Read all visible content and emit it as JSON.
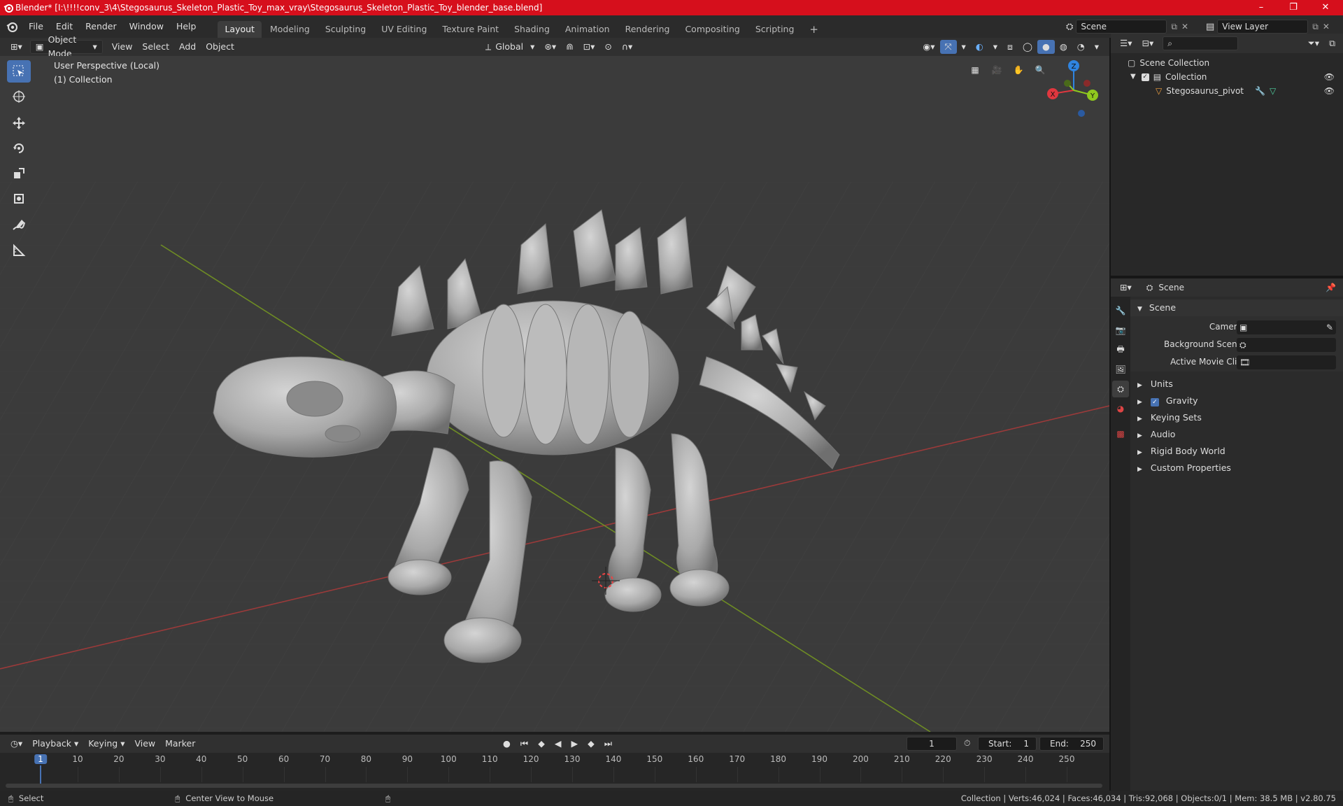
{
  "window": {
    "title": "Blender* [I:\\!!!!conv_3\\4\\Stegosaurus_Skeleton_Plastic_Toy_max_vray\\Stegosaurus_Skeleton_Plastic_Toy_blender_base.blend]",
    "minimize": "–",
    "maximize": "❐",
    "close": "✕"
  },
  "menu": {
    "items": [
      "File",
      "Edit",
      "Render",
      "Window",
      "Help"
    ]
  },
  "workspaces": {
    "tabs": [
      "Layout",
      "Modeling",
      "Sculpting",
      "UV Editing",
      "Texture Paint",
      "Shading",
      "Animation",
      "Rendering",
      "Compositing",
      "Scripting"
    ],
    "add": "+",
    "active_index": 0
  },
  "scene_selector": {
    "value": "Scene"
  },
  "view_layer_selector": {
    "value": "View Layer"
  },
  "viewport_header": {
    "mode": "Object Mode",
    "menus": [
      "View",
      "Select",
      "Add",
      "Object"
    ],
    "transform_orientation": "Global"
  },
  "viewport": {
    "perspective_label": "User Perspective (Local)",
    "collection_label": "(1) Collection",
    "gizmo": {
      "x": "X",
      "y": "Y",
      "z": "Z"
    }
  },
  "outliner": {
    "scene_collection": "Scene Collection",
    "collection": "Collection",
    "object": "Stegosaurus_pivot"
  },
  "properties": {
    "context": "Scene",
    "section_scene": "Scene",
    "fields": [
      {
        "label": "Camera"
      },
      {
        "label": "Background Scene"
      },
      {
        "label": "Active Movie Clip"
      }
    ],
    "subsections": [
      "Units",
      "Gravity",
      "Keying Sets",
      "Audio",
      "Rigid Body World",
      "Custom Properties"
    ],
    "gravity_checked": true
  },
  "timeline": {
    "menus": [
      "Playback",
      "Keying",
      "View",
      "Marker"
    ],
    "current_frame": "1",
    "start_label": "Start:",
    "start": "1",
    "end_label": "End:",
    "end": "250",
    "ticks": [
      1,
      10,
      20,
      30,
      40,
      50,
      60,
      70,
      80,
      90,
      100,
      110,
      120,
      130,
      140,
      150,
      160,
      170,
      180,
      190,
      200,
      210,
      220,
      230,
      240,
      250
    ]
  },
  "statusbar": {
    "select": "Select",
    "center_view": "Center View to Mouse",
    "stats": "Collection | Verts:46,024 | Faces:46,034 | Tris:92,068 | Objects:0/1 | Mem: 38.5 MB | v2.80.75"
  },
  "colors": {
    "titlebar": "#d60f1c",
    "accent": "#4772b3",
    "axis_x": "#e0373f",
    "axis_y": "#8fc81e",
    "axis_z": "#2f84e0"
  }
}
